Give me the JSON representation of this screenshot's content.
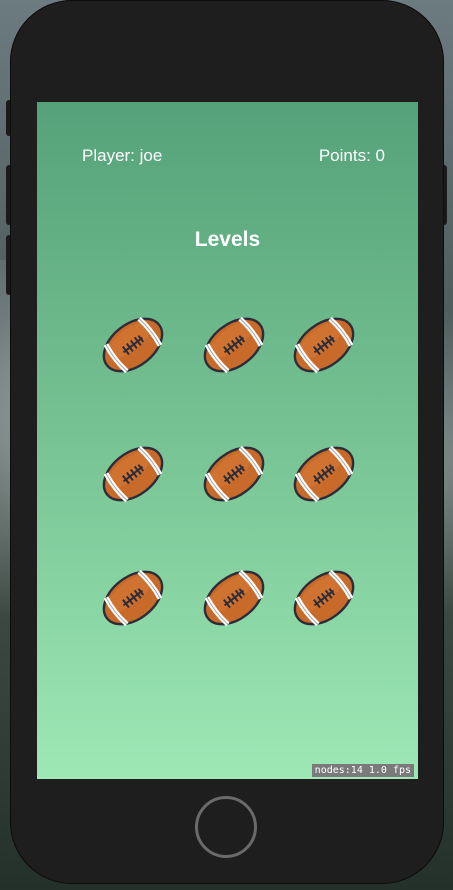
{
  "hud": {
    "player_label": "Player: joe",
    "points_label": "Points: 0"
  },
  "title": "Levels",
  "levels": [
    {
      "icon": "football-icon"
    },
    {
      "icon": "football-icon"
    },
    {
      "icon": "football-icon"
    },
    {
      "icon": "football-icon"
    },
    {
      "icon": "football-icon"
    },
    {
      "icon": "football-icon"
    },
    {
      "icon": "football-icon"
    },
    {
      "icon": "football-icon"
    },
    {
      "icon": "football-icon"
    }
  ],
  "debug": {
    "stats": "nodes:14  1.0 fps"
  },
  "colors": {
    "screen_top": "#55a27a",
    "screen_bottom": "#9de8b5",
    "football_fill": "#c86a2a",
    "football_outline": "#2d2d3a"
  }
}
